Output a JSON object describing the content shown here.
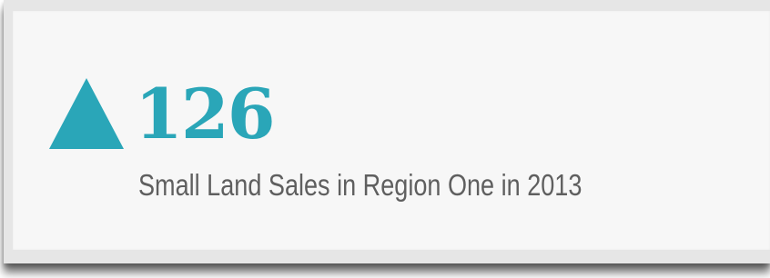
{
  "stat": {
    "value": "126",
    "caption": "Small Land Sales in Region One in 2013",
    "trend_icon": "arrow-up-icon"
  },
  "colors": {
    "accent": "#2aa6b8",
    "caption_text": "#5f5f5f",
    "card_background": "#f7f7f7",
    "frame": "#e6e6e6"
  }
}
